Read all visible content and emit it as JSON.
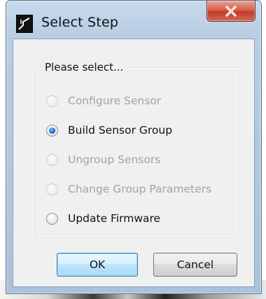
{
  "window": {
    "title": "Select Step",
    "close_glyph": "x",
    "icon": "app-icon"
  },
  "group": {
    "legend": "Please select..."
  },
  "options": [
    {
      "label": "Configure Sensor",
      "enabled": false,
      "checked": false
    },
    {
      "label": "Build Sensor Group",
      "enabled": true,
      "checked": true
    },
    {
      "label": "Ungroup Sensors",
      "enabled": false,
      "checked": false
    },
    {
      "label": "Change Group Parameters",
      "enabled": false,
      "checked": false
    },
    {
      "label": "Update Firmware",
      "enabled": true,
      "checked": false
    }
  ],
  "buttons": {
    "ok_label": "OK",
    "cancel_label": "Cancel"
  },
  "colors": {
    "close_button": "#c23b27",
    "radio_selected": "#1d6fd1",
    "disabled_text": "#a3a3a3"
  }
}
